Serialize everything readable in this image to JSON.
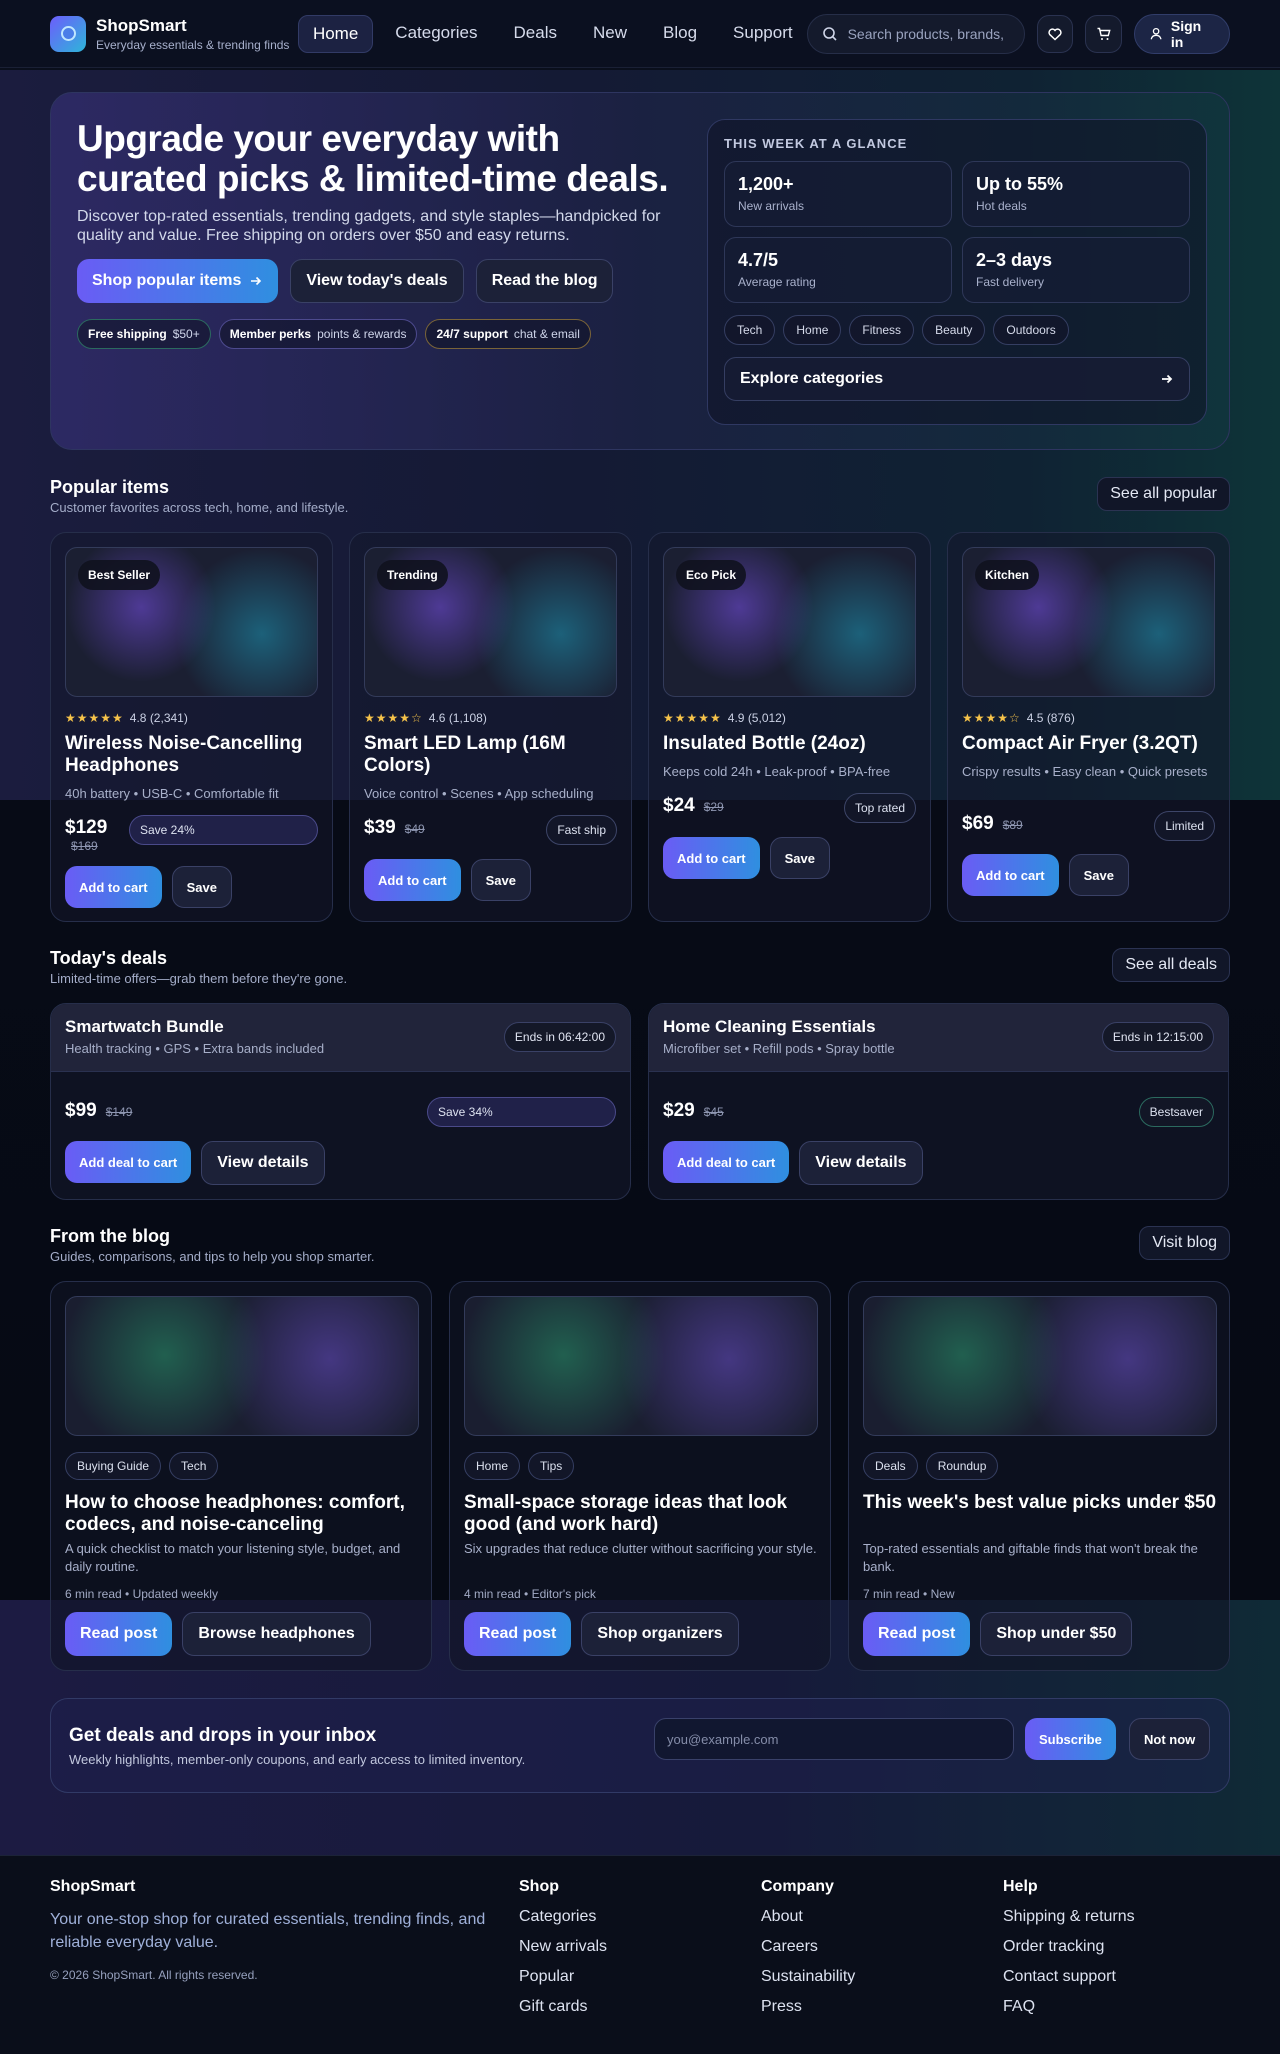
{
  "header": {
    "brand": "ShopSmart",
    "tagline": "Everyday essentials & trending finds",
    "nav": [
      "Home",
      "Categories",
      "Deals",
      "New",
      "Blog",
      "Support"
    ],
    "search_placeholder": "Search products, brands,",
    "signin_label": "Sign in"
  },
  "hero": {
    "title": "Upgrade your everyday with curated picks & limited-time deals.",
    "subtitle": "Discover top-rated essentials, trending gadgets, and style staples—handpicked for quality and value. Free shipping on orders over $50 and easy returns.",
    "cta_primary": "Shop popular items",
    "cta_secondary": "View today's deals",
    "cta_tertiary": "Read the blog",
    "pills": [
      {
        "bold": "Free shipping",
        "text": "$50+"
      },
      {
        "bold": "Member perks",
        "text": "points & rewards"
      },
      {
        "bold": "24/7 support",
        "text": "chat & email"
      }
    ],
    "glance": {
      "heading": "THIS WEEK AT A GLANCE",
      "stats": [
        {
          "value": "1,200+",
          "label": "New arrivals"
        },
        {
          "value": "Up to 55%",
          "label": "Hot deals"
        },
        {
          "value": "4.7/5",
          "label": "Average rating"
        },
        {
          "value": "2–3 days",
          "label": "Fast delivery"
        }
      ],
      "chips": [
        "Tech",
        "Home",
        "Fitness",
        "Beauty",
        "Outdoors"
      ],
      "explore_label": "Explore categories"
    }
  },
  "popular": {
    "title": "Popular items",
    "subtitle": "Customer favorites across tech, home, and lifestyle.",
    "see_all": "See all popular",
    "items": [
      {
        "badge": "Best Seller",
        "stars": "★★★★★",
        "rating": "4.8 (2,341)",
        "title": "Wireless Noise-Cancelling Headphones",
        "desc": "40h battery • USB-C • Comfortable fit",
        "price": "$129",
        "was": "$169",
        "tag": "Save 24%",
        "add": "Add to cart",
        "save": "Save"
      },
      {
        "badge": "Trending",
        "stars": "★★★★☆",
        "rating": "4.6 (1,108)",
        "title": "Smart LED Lamp (16M Colors)",
        "desc": "Voice control • Scenes • App scheduling",
        "price": "$39",
        "was": "$49",
        "tag": "Fast ship",
        "add": "Add to cart",
        "save": "Save"
      },
      {
        "badge": "Eco Pick",
        "stars": "★★★★★",
        "rating": "4.9 (5,012)",
        "title": "Insulated Bottle (24oz)",
        "desc": "Keeps cold 24h • Leak-proof • BPA-free",
        "price": "$24",
        "was": "$29",
        "tag": "Top rated",
        "add": "Add to cart",
        "save": "Save"
      },
      {
        "badge": "Kitchen",
        "stars": "★★★★☆",
        "rating": "4.5 (876)",
        "title": "Compact Air Fryer (3.2QT)",
        "desc": "Crispy results • Easy clean • Quick presets",
        "price": "$69",
        "was": "$89",
        "tag": "Limited",
        "add": "Add to cart",
        "save": "Save"
      }
    ]
  },
  "deals": {
    "title": "Today's deals",
    "subtitle": "Limited-time offers—grab them before they're gone.",
    "see_all": "See all deals",
    "items": [
      {
        "title": "Smartwatch Bundle",
        "desc": "Health tracking • GPS • Extra bands included",
        "ends": "Ends in 06:42:00",
        "price": "$99",
        "was": "$149",
        "tag": "Save 34%",
        "add": "Add deal to cart",
        "view": "View details"
      },
      {
        "title": "Home Cleaning Essentials",
        "desc": "Microfiber set • Refill pods • Spray bottle",
        "ends": "Ends in 12:15:00",
        "price": "$29",
        "was": "$45",
        "tag": "Bestsaver",
        "add": "Add deal to cart",
        "view": "View details"
      }
    ]
  },
  "blog": {
    "title": "From the blog",
    "subtitle": "Guides, comparisons, and tips to help you shop smarter.",
    "visit": "Visit blog",
    "posts": [
      {
        "tags": [
          "Buying Guide",
          "Tech"
        ],
        "title": "How to choose headphones: comfort, codecs, and noise-canceling",
        "desc": "A quick checklist to match your listening style, budget, and daily routine.",
        "meta": "6 min read  •  Updated weekly",
        "read": "Read post",
        "shop": "Browse headphones"
      },
      {
        "tags": [
          "Home",
          "Tips"
        ],
        "title": "Small-space storage ideas that look good (and work hard)",
        "desc": "Six upgrades that reduce clutter without sacrificing your style.",
        "meta": "4 min read  •  Editor's pick",
        "read": "Read post",
        "shop": "Shop organizers"
      },
      {
        "tags": [
          "Deals",
          "Roundup"
        ],
        "title": "This week's best value picks under $50",
        "desc": "Top-rated essentials and giftable finds that won't break the bank.",
        "meta": "7 min read  •  New",
        "read": "Read post",
        "shop": "Shop under $50"
      }
    ]
  },
  "newsletter": {
    "title": "Get deals and drops in your inbox",
    "subtitle": "Weekly highlights, member-only coupons, and early access to limited inventory.",
    "placeholder": "you@example.com",
    "subscribe": "Subscribe",
    "not_now": "Not now"
  },
  "footer": {
    "brand": "ShopSmart",
    "about": "Your one-stop shop for curated essentials, trending finds, and reliable everyday value.",
    "copyright": "© 2026 ShopSmart. All rights reserved.",
    "columns": [
      {
        "title": "Shop",
        "links": [
          "Categories",
          "New arrivals",
          "Popular",
          "Gift cards"
        ]
      },
      {
        "title": "Company",
        "links": [
          "About",
          "Careers",
          "Sustainability",
          "Press"
        ]
      },
      {
        "title": "Help",
        "links": [
          "Shipping & returns",
          "Order tracking",
          "Contact support",
          "FAQ"
        ]
      }
    ]
  }
}
